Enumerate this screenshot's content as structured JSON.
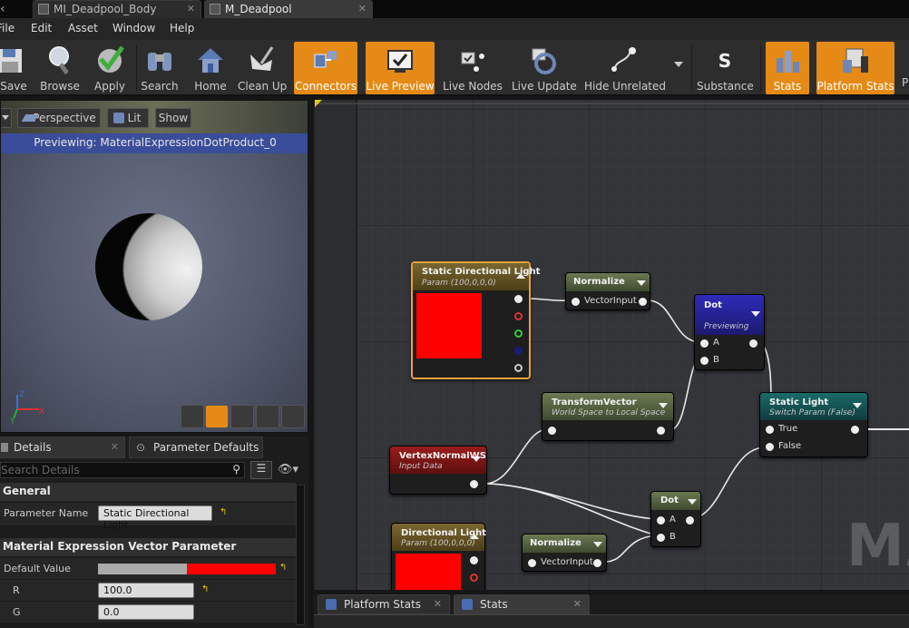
{
  "tabs": [
    {
      "label": "MI_Deadpool_Body"
    },
    {
      "label": "M_Deadpool"
    }
  ],
  "menu": [
    "File",
    "Edit",
    "Asset",
    "Window",
    "Help"
  ],
  "toolbar": {
    "save": "Save",
    "browse": "Browse",
    "apply": "Apply",
    "search": "Search",
    "home": "Home",
    "cleanup": "Clean Up",
    "connectors": "Connectors",
    "live_preview": "Live Preview",
    "live_nodes": "Live Nodes",
    "live_update": "Live Update",
    "hide_unrelated": "Hide Unrelated",
    "substance": "Substance",
    "stats": "Stats",
    "platform_stats": "Platform Stats"
  },
  "viewport": {
    "perspective": "Perspective",
    "lit": "Lit",
    "show": "Show",
    "banner": "Previewing: MaterialExpressionDotProduct_0"
  },
  "details": {
    "tab_details": "Details",
    "tab_params": "Parameter Defaults",
    "search_placeholder": "Search Details",
    "general": "General",
    "param_name_label": "Parameter Name",
    "param_name_value": "Static Directional Light",
    "mev_section": "Material Expression Vector Parameter",
    "default_value_label": "Default Value",
    "r_label": "R",
    "r_value": "100.0",
    "g_label": "G",
    "g_value": "0.0"
  },
  "nodes": {
    "sdl": {
      "title": "Static Directional Light",
      "sub": "Param (100,0,0,0)"
    },
    "norm1": {
      "title": "Normalize",
      "pin": "VectorInput"
    },
    "dot1": {
      "title": "Dot",
      "sub": "Previewing",
      "a": "A",
      "b": "B"
    },
    "tv": {
      "title": "TransformVector",
      "sub": "World Space to Local Space"
    },
    "sl": {
      "title": "Static Light",
      "sub": "Switch Param (False)",
      "t": "True",
      "f": "False"
    },
    "vn": {
      "title": "VertexNormalWS",
      "sub": "Input Data"
    },
    "dot2": {
      "title": "Dot",
      "a": "A",
      "b": "B"
    },
    "dl": {
      "title": "Directional Light",
      "sub": "Param (100,0,0,0)"
    },
    "norm2": {
      "title": "Normalize",
      "pin": "VectorInput"
    }
  },
  "watermark": "MA",
  "bottom_tabs": {
    "platform_stats": "Platform Stats",
    "stats": "Stats"
  },
  "colors": {
    "accent": "#e58a17",
    "param_node": "#6b5624",
    "dot_node": "#2b2a9a",
    "vertex_node": "#8a1a1a",
    "static_light_node": "#155a5a",
    "red_preview": "#ff0000"
  }
}
